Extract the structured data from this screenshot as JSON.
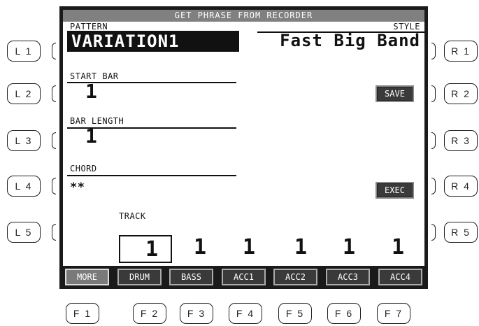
{
  "side_buttons": {
    "left": [
      "L 1",
      "L 2",
      "L 3",
      "L 4",
      "L 5"
    ],
    "right": [
      "R 1",
      "R 2",
      "R 3",
      "R 4",
      "R 5"
    ],
    "bottom": [
      "F 1",
      "F 2",
      "F 3",
      "F 4",
      "F 5",
      "F 6",
      "F 7"
    ]
  },
  "screen": {
    "title": "GET PHRASE FROM RECORDER",
    "pattern_label": "PATTERN",
    "pattern_value": "VARIATION1",
    "style_label": "STYLE",
    "style_value": "Fast Big Band",
    "start_bar_label": "START BAR",
    "start_bar_value": "1",
    "bar_length_label": "BAR LENGTH",
    "bar_length_value": "1",
    "chord_label": "CHORD",
    "chord_value": "**",
    "save_label": "SAVE",
    "exec_label": "EXEC",
    "track_label": "TRACK",
    "tracks": [
      "1",
      "1",
      "1",
      "1",
      "1",
      "1"
    ],
    "tabs": [
      "MORE",
      "DRUM",
      "BASS",
      "ACC1",
      "ACC2",
      "ACC3",
      "ACC4"
    ],
    "active_tab": "MORE"
  },
  "colors": {
    "display_bg": "#ffffff",
    "frame": "#1a1a1a",
    "title_bg": "#808080",
    "button_bg": "#3a3a3a"
  }
}
